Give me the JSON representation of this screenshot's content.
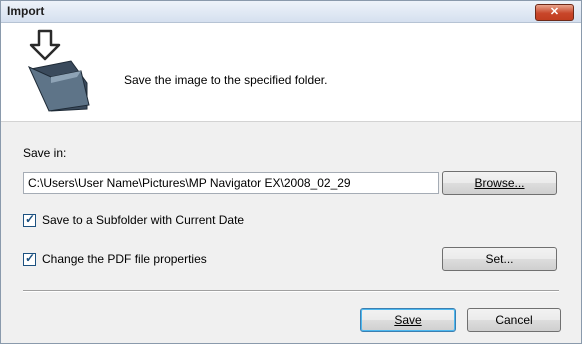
{
  "window": {
    "title": "Import",
    "close_label": "✕"
  },
  "header": {
    "text": "Save the image to the specified folder.",
    "icon": "download-folder-icon"
  },
  "save_in": {
    "label": "Save in:",
    "path": "C:\\Users\\User Name\\Pictures\\MP Navigator EX\\2008_02_29",
    "browse_label": "Browse..."
  },
  "options": {
    "subfolder_label": "Save to a Subfolder with Current Date",
    "subfolder_checked": true,
    "pdf_label": "Change the PDF file properties",
    "pdf_checked": true,
    "set_label": "Set..."
  },
  "footer": {
    "save_label": "Save",
    "cancel_label": "Cancel"
  }
}
